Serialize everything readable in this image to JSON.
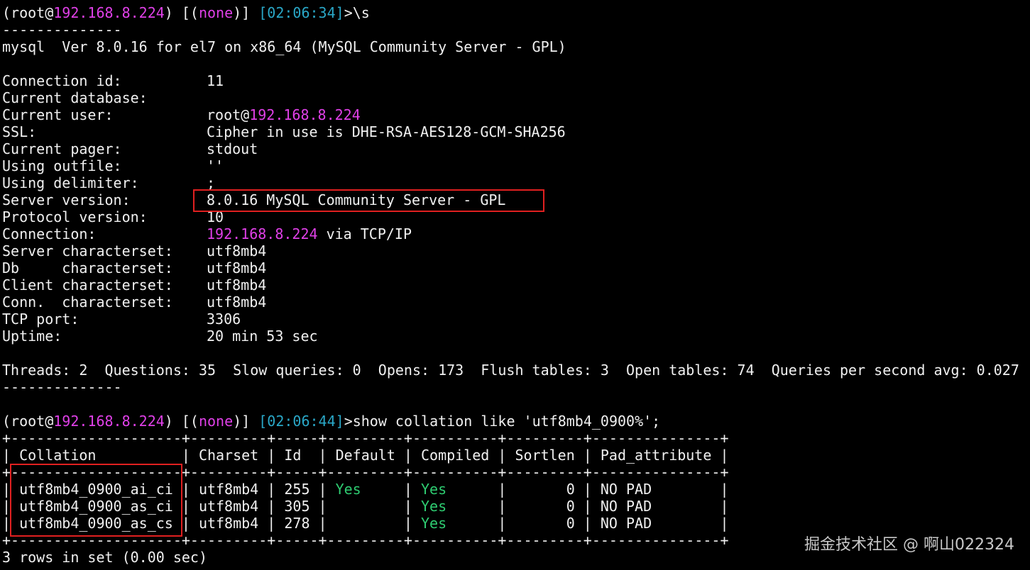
{
  "prompt1": {
    "open": "(root@",
    "host": "192.168.8.224",
    "mid": ") [(",
    "db": "none",
    "close": ")] ",
    "time": "[02:06:34]",
    "command": ">\\s"
  },
  "divider": "--------------",
  "version_line": "mysql  Ver 8.0.16 for el7 on x86_64 (MySQL Community Server - GPL)",
  "status": [
    {
      "label": "Connection id:",
      "value": "11"
    },
    {
      "label": "Current database:",
      "value": ""
    },
    {
      "label": "Current user:",
      "value": "root@",
      "value_host": "192.168.8.224"
    },
    {
      "label": "SSL:",
      "value": "Cipher in use is DHE-RSA-AES128-GCM-SHA256"
    },
    {
      "label": "Current pager:",
      "value": "stdout"
    },
    {
      "label": "Using outfile:",
      "value": "''"
    },
    {
      "label": "Using delimiter:",
      "value": ";"
    },
    {
      "label": "Server version:",
      "value": "8.0.16 MySQL Community Server - GPL"
    },
    {
      "label": "Protocol version:",
      "value": "10"
    },
    {
      "label": "Connection:",
      "value_host": "192.168.8.224",
      "value": " via TCP/IP"
    },
    {
      "label": "Server characterset:",
      "value": "utf8mb4"
    },
    {
      "label": "Db     characterset:",
      "value": "utf8mb4"
    },
    {
      "label": "Client characterset:",
      "value": "utf8mb4"
    },
    {
      "label": "Conn.  characterset:",
      "value": "utf8mb4"
    },
    {
      "label": "TCP port:",
      "value": "3306"
    },
    {
      "label": "Uptime:",
      "value": "20 min 53 sec"
    }
  ],
  "stats_line": "Threads: 2  Questions: 35  Slow queries: 0  Opens: 173  Flush tables: 3  Open tables: 74  Queries per second avg: 0.027",
  "prompt2": {
    "open": "(root@",
    "host": "192.168.8.224",
    "mid": ") [(",
    "db": "none",
    "close": ")] ",
    "time": "[02:06:44]",
    "command": ">show collation like 'utf8mb4_0900%';"
  },
  "table": {
    "border": "+--------------------+---------+-----+---------+----------+---------+---------------+",
    "headers": [
      "Collation",
      "Charset",
      "Id",
      "Default",
      "Compiled",
      "Sortlen",
      "Pad_attribute"
    ],
    "rows": [
      [
        "utf8mb4_0900_ai_ci",
        "utf8mb4",
        "255",
        "Yes",
        "Yes",
        "0",
        "NO PAD"
      ],
      [
        "utf8mb4_0900_as_ci",
        "utf8mb4",
        "305",
        "",
        "Yes",
        "0",
        "NO PAD"
      ],
      [
        "utf8mb4_0900_as_cs",
        "utf8mb4",
        "278",
        "",
        "Yes",
        "0",
        "NO PAD"
      ]
    ]
  },
  "result_line": "3 rows in set (0.00 sec)",
  "watermark": "掘金技术社区 @ 啊山022324",
  "colors": {
    "background": "#000000",
    "text": "#f0f0f0",
    "host": "#e040e8",
    "timestamp": "#2aa8c8",
    "yes": "#2ecc71",
    "highlight_box": "#e02020"
  }
}
